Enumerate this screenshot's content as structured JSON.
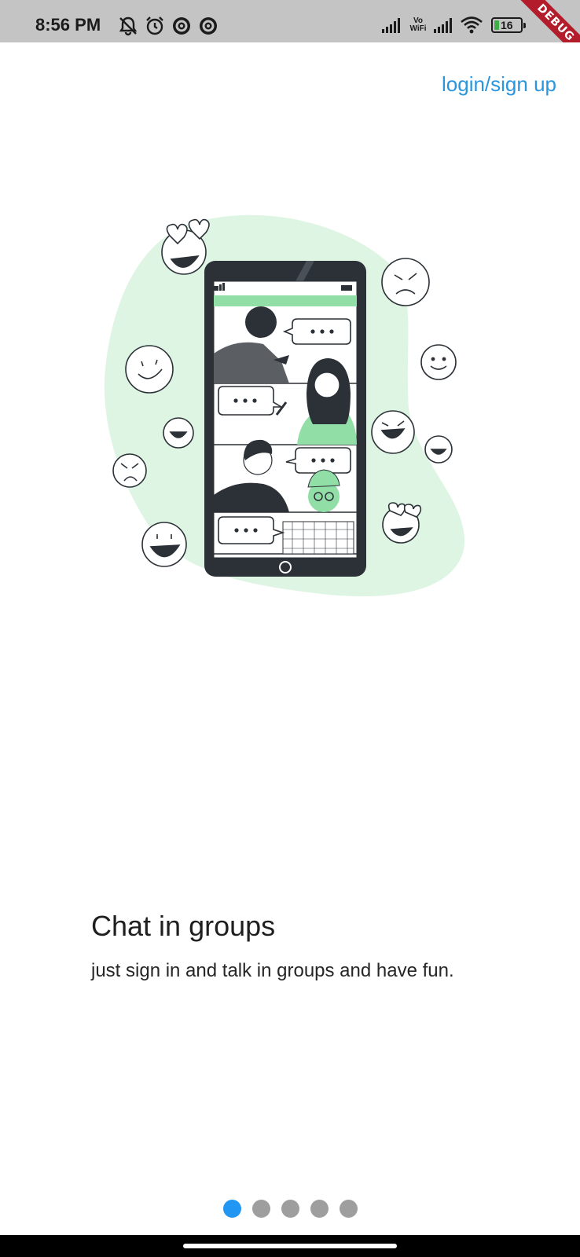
{
  "status_bar": {
    "time": "8:56 PM",
    "network_label": "Vo\nWiFi",
    "battery_level": "16",
    "left_icons": [
      "mute-icon",
      "alarm-icon",
      "at-icon",
      "at-icon"
    ],
    "right_icons": [
      "signal-icon",
      "vowifi-icon",
      "signal-icon",
      "wifi-icon",
      "battery-icon"
    ]
  },
  "debug_banner": "DEBUG",
  "header": {
    "login_label": "login/sign up"
  },
  "onboarding": {
    "title": "Chat in groups",
    "subtitle": "just sign in and talk in groups and have fun.",
    "page_count": 5,
    "active_page": 1
  },
  "colors": {
    "accent": "#2a96df",
    "dot_active": "#2196f3",
    "dot_inactive": "#9e9e9e",
    "blob": "#dff5e4",
    "illustration_green": "#92dea7"
  }
}
